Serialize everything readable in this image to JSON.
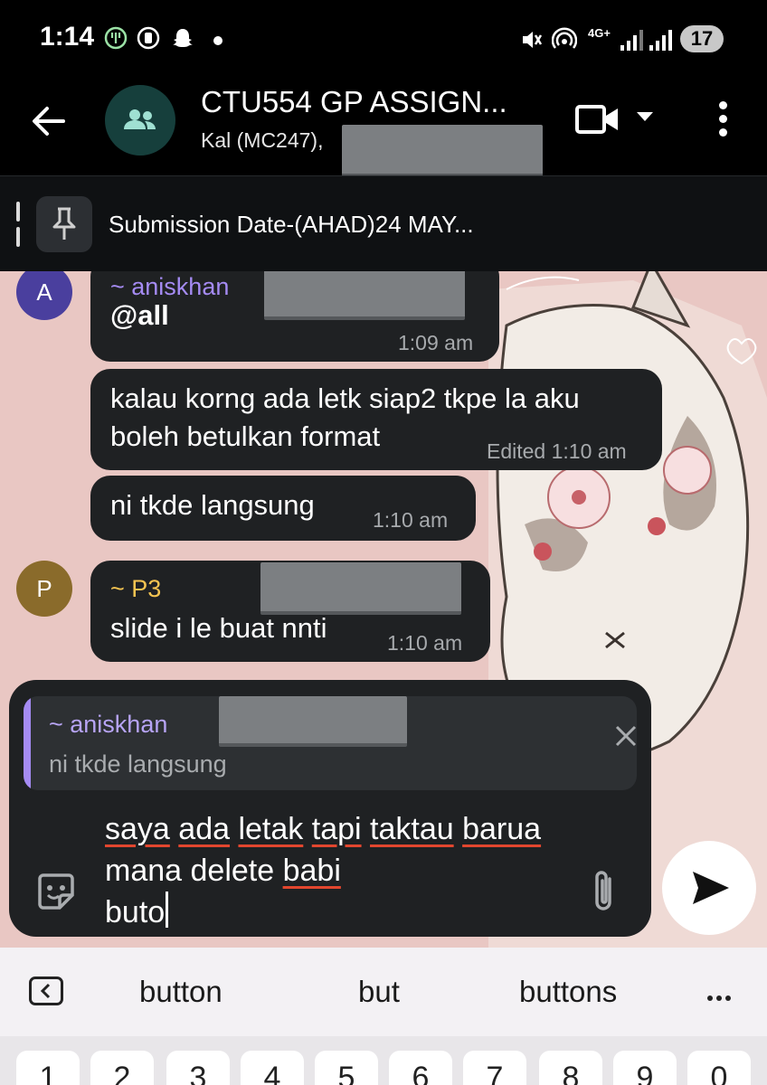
{
  "status_bar": {
    "time": "1:14",
    "network": "4G+",
    "battery": "17"
  },
  "header": {
    "title": "CTU554 GP ASSIGN...",
    "subtitle": "Kal (MC247),"
  },
  "pinned": {
    "text": "Submission Date-(AHAD)24 MAY..."
  },
  "messages": [
    {
      "avatar": "A",
      "sender": "~ aniskhan",
      "text": "@all",
      "time": "1:09 am"
    },
    {
      "text_line1": "kalau korng ada letk siap2 tkpe la aku",
      "text_line2": "boleh betulkan format",
      "time": "Edited 1:10 am"
    },
    {
      "text": "ni tkde langsung",
      "time": "1:10 am"
    },
    {
      "avatar": "P",
      "sender": "~ P3",
      "text": "slide i le buat nnti",
      "time": "1:10 am"
    }
  ],
  "reply": {
    "sender": "~ aniskhan",
    "text": "ni tkde langsung"
  },
  "compose": {
    "w1": "saya",
    "w2": "ada",
    "w3": "letak",
    "w4": "tapi",
    "w5": "taktau",
    "w6": "barua",
    "w7": "mana delete",
    "w8": "babi",
    "w9": "buto"
  },
  "keyboard": {
    "suggestions": [
      "button",
      "but",
      "buttons"
    ],
    "number_row": [
      "1",
      "2",
      "3",
      "4",
      "5",
      "6",
      "7",
      "8",
      "9",
      "0"
    ]
  },
  "colors": {
    "accent_sender_a": "#a58bf3",
    "accent_sender_p": "#f5c451",
    "avatar_a": "#4a3f9e",
    "avatar_p": "#8a6b2b",
    "bubble": "#1f2123"
  }
}
